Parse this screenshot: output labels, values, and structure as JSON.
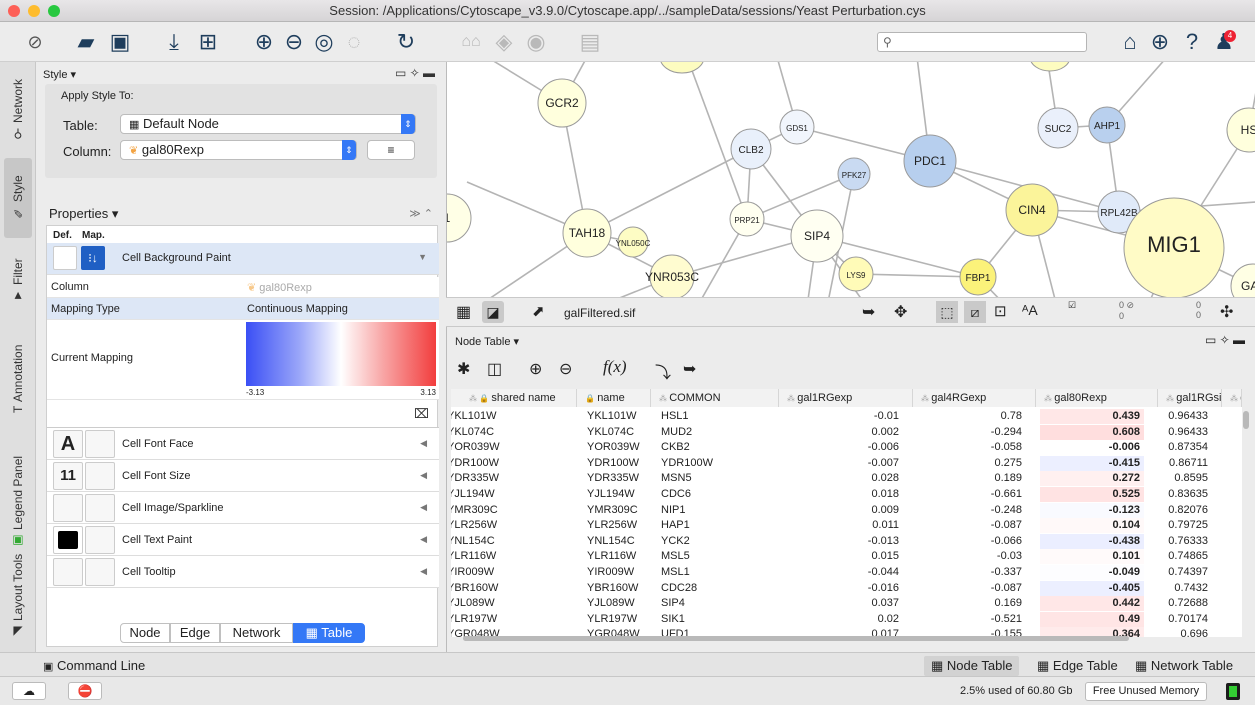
{
  "window": {
    "title": "Session: /Applications/Cytoscape_v3.9.0/Cytoscape.app/../sampleData/sessions/Yeast Perturbation.cys"
  },
  "toolbar": {
    "search_placeholder": ""
  },
  "left_tabs": [
    "Network",
    "Style",
    "Filter",
    "Annotation",
    "Legend Panel",
    "Layout Tools"
  ],
  "style_panel": {
    "header": "Style ▾",
    "apply_to": "Apply Style To:",
    "table_label": "Table:",
    "table_value": "Default Node",
    "column_label": "Column:",
    "column_value": "gal80Rexp",
    "properties_header": "Properties ▾",
    "def_label": "Def.",
    "map_label": "Map.",
    "bg_paint": "Cell Background Paint",
    "details": {
      "column_key": "Column",
      "column_val": "gal80Rexp",
      "mapping_type_key": "Mapping Type",
      "mapping_type_val": "Continuous Mapping",
      "current_mapping_key": "Current Mapping",
      "min": "-3.13",
      "max": "3.13"
    },
    "rows": [
      {
        "label": "Cell Font Face",
        "def": "A"
      },
      {
        "label": "Cell Font Size",
        "def": "11"
      },
      {
        "label": "Cell Image/Sparkline",
        "def": ""
      },
      {
        "label": "Cell Text Paint",
        "def": ""
      },
      {
        "label": "Cell Tooltip",
        "def": ""
      }
    ],
    "segments": [
      "Node",
      "Edge",
      "Network",
      "Table"
    ]
  },
  "network": {
    "file": "galFiltered.sif",
    "counts": [
      "0",
      "0",
      "0",
      "0"
    ],
    "nodes": [
      {
        "label": "GCR2",
        "color": "#ffffdd"
      },
      {
        "label": "CLB2",
        "color": "#e9f0fb"
      },
      {
        "label": "GDS1",
        "color": "#f1f5fc"
      },
      {
        "label": "PFK27",
        "color": "#c9daf2"
      },
      {
        "label": "PDC1",
        "color": "#b7cfee"
      },
      {
        "label": "SUC2",
        "color": "#eaf0fb"
      },
      {
        "label": "AHP1",
        "color": "#b9d0ee"
      },
      {
        "label": "HS",
        "color": "#ffffdd"
      },
      {
        "label": "CIN4",
        "color": "#fbf49a"
      },
      {
        "label": "RPL42B",
        "color": "#e0eaf9"
      },
      {
        "label": "TAH18",
        "color": "#ffffdd"
      },
      {
        "label": "YNL050C",
        "color": "#fdfcc4"
      },
      {
        "label": "PRP21",
        "color": "#fffff0"
      },
      {
        "label": "SIP4",
        "color": "#fffff2"
      },
      {
        "label": "LYS9",
        "color": "#fffbb8"
      },
      {
        "label": "FBP1",
        "color": "#fbf27a"
      },
      {
        "label": "MIG1",
        "color": "#fffbc6"
      },
      {
        "label": "GAL",
        "color": "#ffffe4"
      },
      {
        "label": "YNR053C",
        "color": "#fffcd0"
      },
      {
        "label": "1",
        "color": "#ffffe6"
      }
    ]
  },
  "node_table": {
    "header": "Node Table ▾",
    "columns": [
      "shared name",
      "name",
      "COMMON",
      "gal1RGexp",
      "gal4RGexp",
      "gal80Rexp",
      "gal1RGsig",
      "g"
    ],
    "rows": [
      [
        "YKL101W",
        "YKL101W",
        "HSL1",
        "-0.01",
        "0.78",
        "0.439",
        "0.96433"
      ],
      [
        "YKL074C",
        "YKL074C",
        "MUD2",
        "0.002",
        "-0.294",
        "0.608",
        "0.96433"
      ],
      [
        "YOR039W",
        "YOR039W",
        "CKB2",
        "-0.006",
        "-0.058",
        "-0.006",
        "0.87354"
      ],
      [
        "YDR100W",
        "YDR100W",
        "YDR100W",
        "-0.007",
        "0.275",
        "-0.415",
        "0.86711"
      ],
      [
        "YDR335W",
        "YDR335W",
        "MSN5",
        "0.028",
        "0.189",
        "0.272",
        "0.8595"
      ],
      [
        "YJL194W",
        "YJL194W",
        "CDC6",
        "0.018",
        "-0.661",
        "0.525",
        "0.83635"
      ],
      [
        "YMR309C",
        "YMR309C",
        "NIP1",
        "0.009",
        "-0.248",
        "-0.123",
        "0.82076"
      ],
      [
        "YLR256W",
        "YLR256W",
        "HAP1",
        "0.011",
        "-0.087",
        "0.104",
        "0.79725"
      ],
      [
        "YNL154C",
        "YNL154C",
        "YCK2",
        "-0.013",
        "-0.066",
        "-0.438",
        "0.76333"
      ],
      [
        "YLR116W",
        "YLR116W",
        "MSL5",
        "0.015",
        "-0.03",
        "0.101",
        "0.74865"
      ],
      [
        "YIR009W",
        "YIR009W",
        "MSL1",
        "-0.044",
        "-0.337",
        "-0.049",
        "0.74397"
      ],
      [
        "YBR160W",
        "YBR160W",
        "CDC28",
        "-0.016",
        "-0.087",
        "-0.405",
        "0.7432"
      ],
      [
        "YJL089W",
        "YJL089W",
        "SIP4",
        "0.037",
        "0.169",
        "0.442",
        "0.72688"
      ],
      [
        "YLR197W",
        "YLR197W",
        "SIK1",
        "0.02",
        "-0.521",
        "0.49",
        "0.70174"
      ],
      [
        "YGR048W",
        "YGR048W",
        "UFD1",
        "0.017",
        "-0.155",
        "0.364",
        "0.696"
      ]
    ]
  },
  "bottom": {
    "command_line": "Command Line",
    "tabs": [
      "Node Table",
      "Edge Table",
      "Network Table"
    ]
  },
  "status": {
    "memory": "2.5% used of 60.80 Gb",
    "free_button": "Free Unused Memory"
  }
}
